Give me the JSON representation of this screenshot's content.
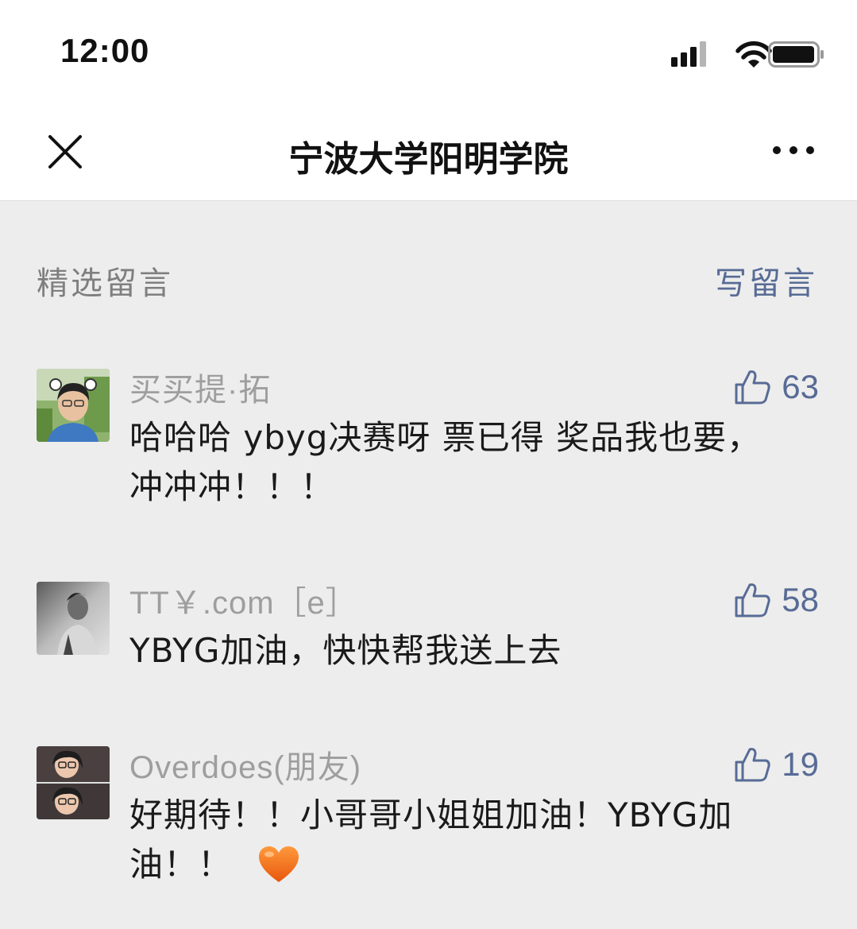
{
  "status": {
    "time": "12:00"
  },
  "nav": {
    "title": "宁波大学阳明学院"
  },
  "section": {
    "title": "精选留言",
    "write_label": "写留言"
  },
  "comments": [
    {
      "nickname": "买买提·拓",
      "likes": "63",
      "text": "哈哈哈 ybyg决赛呀 票已得 奖品我也要，冲冲冲！！！",
      "avatar": "avatar-boy-with-ears"
    },
    {
      "nickname": "TT￥.com［e］",
      "likes": "58",
      "text": "YBYG加油，快快帮我送上去",
      "avatar": "avatar-bw-man"
    },
    {
      "nickname": "Overdoes(朋友)",
      "likes": "19",
      "text": "好期待！！小哥哥小姐姐加油！YBYG加油！！",
      "emoji": "❤",
      "avatar": "avatar-girl-glasses"
    }
  ],
  "colors": {
    "link": "#576b95",
    "muted": "#9e9e9e",
    "background": "#ededed",
    "heart": "#f06a1c"
  }
}
